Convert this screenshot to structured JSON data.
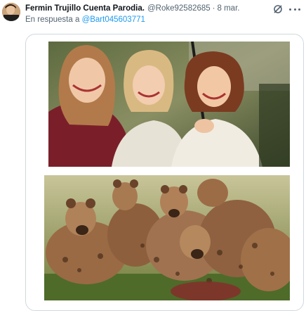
{
  "tweet": {
    "author_name": "Fermin Trujillo Cuenta Parodia.",
    "author_handle": "@Roke92582685",
    "separator": "·",
    "date": "8 mar.",
    "reply_prefix": "En respuesta a",
    "reply_mention": "@Bart045603771"
  },
  "icons": {
    "avatar": "avatar",
    "grok": "grok-icon",
    "more": "more-icon"
  },
  "media": {
    "images": [
      {
        "name": "photo-three-women-umbrella"
      },
      {
        "name": "photo-hyenas-pack"
      }
    ]
  },
  "colors": {
    "secondary_text": "#536471",
    "link": "#1d9bf0",
    "border": "#cfd9de"
  }
}
